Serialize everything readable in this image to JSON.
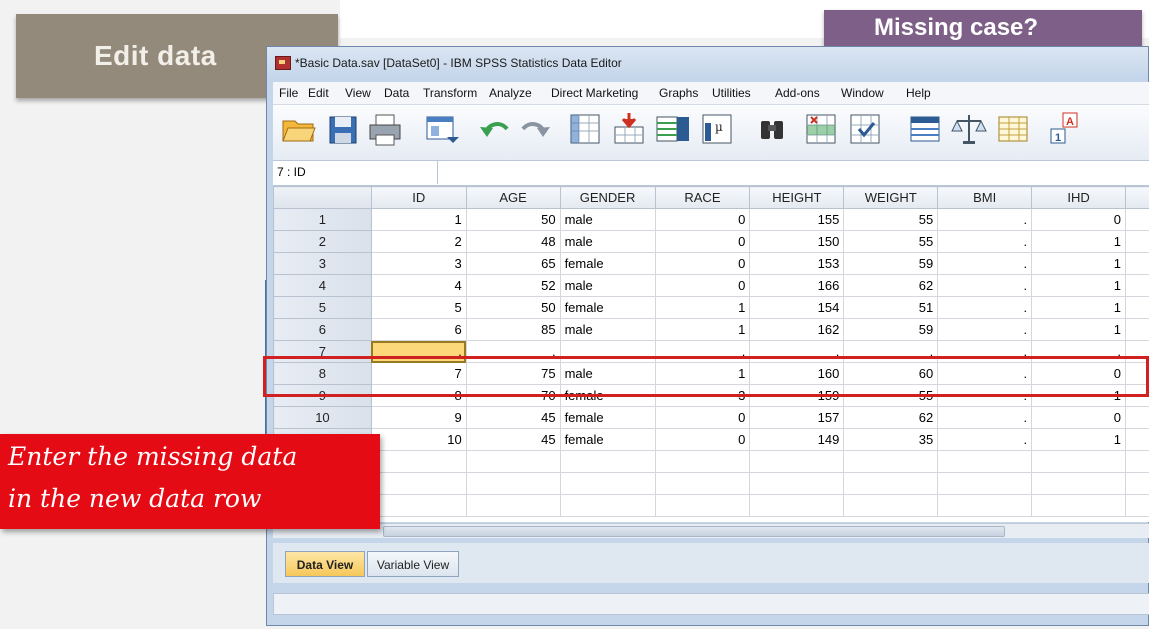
{
  "slide": {
    "title": "Edit data",
    "question": "Missing case?",
    "callout_line1": "Enter the missing data",
    "callout_line2": "in the new data row"
  },
  "window": {
    "title": "*Basic Data.sav [DataSet0] - IBM SPSS Statistics Data Editor"
  },
  "menu": [
    "File",
    "Edit",
    "View",
    "Data",
    "Transform",
    "Analyze",
    "Direct Marketing",
    "Graphs",
    "Utilities",
    "Add-ons",
    "Window",
    "Help"
  ],
  "toolbar_icons": [
    "open-icon",
    "save-icon",
    "print-icon",
    "dialog-recall-icon",
    "undo-icon",
    "redo-icon",
    "goto-case-icon",
    "goto-variable-icon",
    "variables-icon",
    "descriptive-icon",
    "find-icon",
    "insert-cases-icon",
    "insert-variable-icon",
    "split-file-icon",
    "weight-cases-icon",
    "select-cases-icon",
    "value-labels-icon"
  ],
  "cell_ref": "7 : ID",
  "cell_value": "",
  "grid": {
    "columns": [
      "ID",
      "AGE",
      "GENDER",
      "RACE",
      "HEIGHT",
      "WEIGHT",
      "BMI",
      "IHD"
    ],
    "rows": [
      {
        "num": "1",
        "cells": [
          "1",
          "50",
          "male",
          "0",
          "155",
          "55",
          ".",
          "0"
        ]
      },
      {
        "num": "2",
        "cells": [
          "2",
          "48",
          "male",
          "0",
          "150",
          "55",
          ".",
          "1"
        ]
      },
      {
        "num": "3",
        "cells": [
          "3",
          "65",
          "female",
          "0",
          "153",
          "59",
          ".",
          "1"
        ]
      },
      {
        "num": "4",
        "cells": [
          "4",
          "52",
          "male",
          "0",
          "166",
          "62",
          ".",
          "1"
        ]
      },
      {
        "num": "5",
        "cells": [
          "5",
          "50",
          "female",
          "1",
          "154",
          "51",
          ".",
          "1"
        ]
      },
      {
        "num": "6",
        "cells": [
          "6",
          "85",
          "male",
          "1",
          "162",
          "59",
          ".",
          "1"
        ]
      },
      {
        "num": "7",
        "cells": [
          ".",
          ".",
          "",
          ".",
          ".",
          ".",
          ".",
          "."
        ]
      },
      {
        "num": "8",
        "cells": [
          "7",
          "75",
          "male",
          "1",
          "160",
          "60",
          ".",
          "0"
        ]
      },
      {
        "num": "9",
        "cells": [
          "8",
          "70",
          "female",
          "3",
          "159",
          "55",
          ".",
          "1"
        ]
      },
      {
        "num": "10",
        "cells": [
          "9",
          "45",
          "female",
          "0",
          "157",
          "62",
          ".",
          "0"
        ]
      },
      {
        "num": "11",
        "cells": [
          "10",
          "45",
          "female",
          "0",
          "149",
          "35",
          ".",
          "1"
        ]
      },
      {
        "num": "",
        "cells": [
          "",
          "",
          "",
          "",
          "",
          "",
          "",
          ""
        ]
      },
      {
        "num": "",
        "cells": [
          "",
          "",
          "",
          "",
          "",
          "",
          "",
          ""
        ]
      },
      {
        "num": "",
        "cells": [
          "",
          "",
          "",
          "",
          "",
          "",
          "",
          ""
        ]
      }
    ],
    "active_row": 7
  },
  "tabs": {
    "data_view": "Data View",
    "variable_view": "Variable View"
  },
  "colors": {
    "title_box": "#948a7b",
    "question_box": "#7d5f87",
    "callout": "#e50b14",
    "highlight_border": "#d02020",
    "active_cell": "#fcd87a"
  }
}
